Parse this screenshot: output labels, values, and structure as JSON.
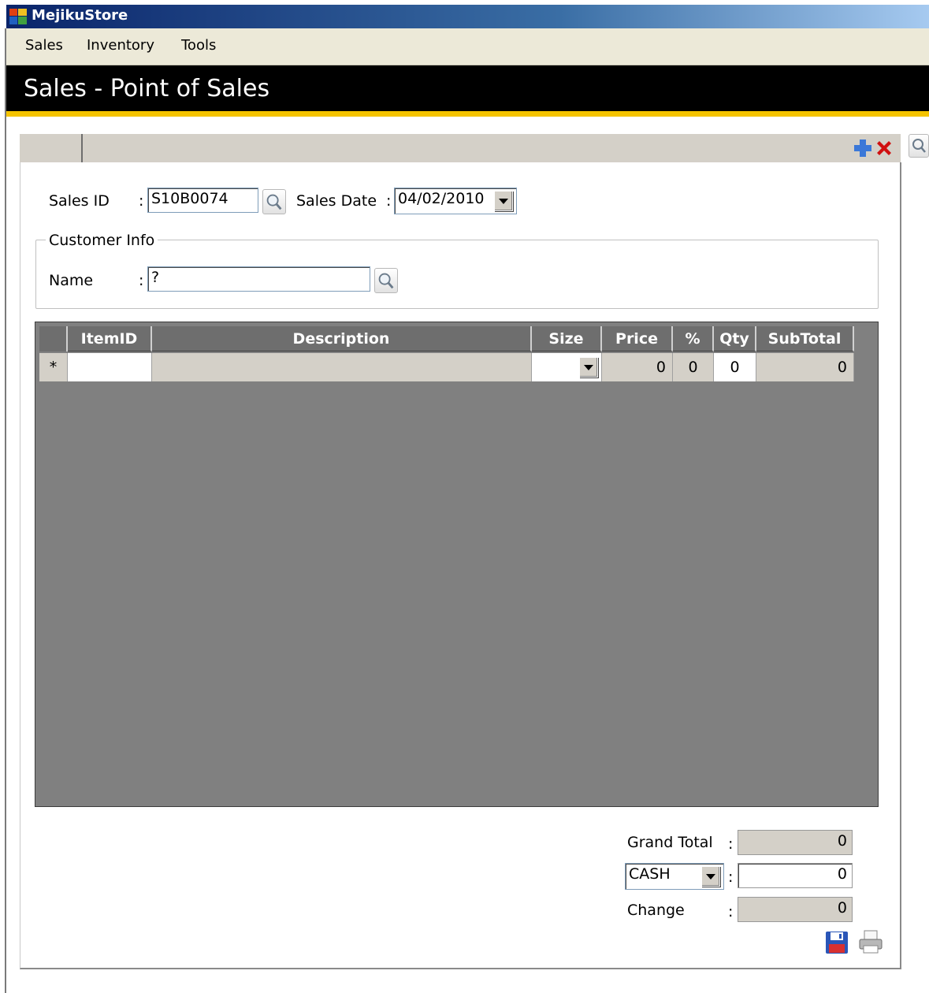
{
  "window": {
    "title": "MejikuStore"
  },
  "menu": {
    "items": [
      "Sales",
      "Inventory",
      "Tools"
    ]
  },
  "page": {
    "title": "Sales - Point of Sales"
  },
  "form": {
    "sales_id_label": "Sales ID",
    "sales_id_value": "S10B0074",
    "sales_date_label": "Sales Date",
    "sales_date_value": "04/02/2010",
    "customer_group_label": "Customer Info",
    "name_label": "Name",
    "name_value": "?",
    "colon": ":"
  },
  "grid": {
    "columns": [
      "ItemID",
      "Description",
      "Size",
      "Price",
      "%",
      "Qty",
      "SubTotal"
    ],
    "new_row": {
      "marker": "*",
      "item_id": "",
      "description": "",
      "size": "",
      "price": "0",
      "discount": "0",
      "qty": "0",
      "subtotal": "0"
    }
  },
  "totals": {
    "grand_total_label": "Grand Total",
    "grand_total_value": "0",
    "payment_method": "CASH",
    "payment_value": "0",
    "change_label": "Change",
    "change_value": "0"
  },
  "icons": {
    "add": "plus-icon",
    "delete": "x-icon",
    "search": "magnifier-icon",
    "save": "floppy-icon",
    "print": "printer-icon"
  },
  "colors": {
    "header_bg": "#000000",
    "accent": "#f5c400",
    "grid_bg": "#808080",
    "add_icon": "#3b78d8",
    "delete_icon": "#d01010"
  }
}
